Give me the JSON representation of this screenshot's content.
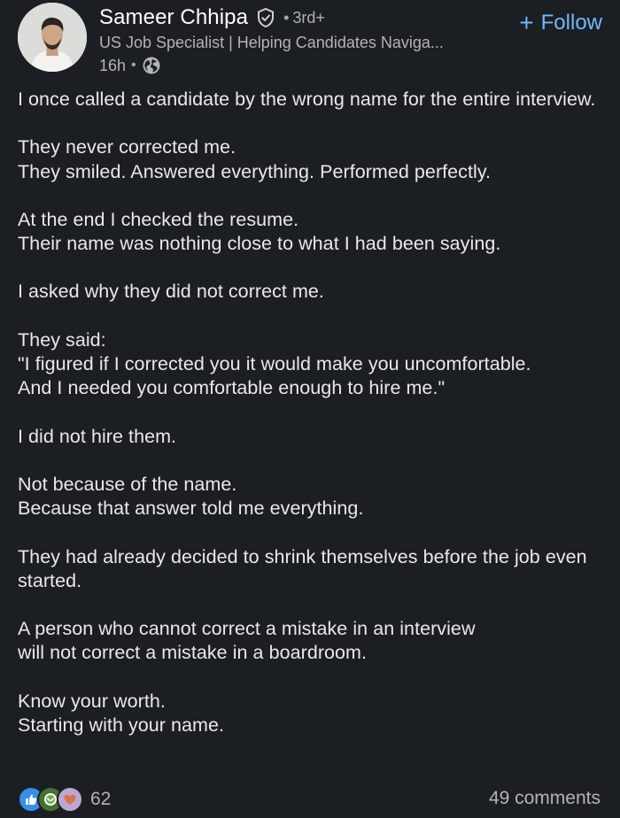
{
  "author": {
    "name": "Sameer Chhipa",
    "degree": "3rd+",
    "separator": "•",
    "headline": "US Job Specialist | Helping Candidates Naviga...",
    "time_ago": "16h"
  },
  "follow": {
    "plus": "+",
    "label": "Follow"
  },
  "post": {
    "paragraphs": [
      "I once called a candidate by the wrong name for the entire interview.",
      "They never corrected me.\nThey smiled. Answered everything. Performed perfectly.",
      "At the end I checked the resume.\nTheir name was nothing close to what I had been saying.",
      "I asked why they did not correct me.",
      "They said:\n\"I figured if I corrected you it would make you uncomfortable.\nAnd I needed you comfortable enough to hire me.\"",
      "I did not hire them.",
      "Not because of the name.\nBecause that answer told me everything.",
      "They had already decided to shrink themselves before the job even started.",
      "A person who cannot correct a mistake in an interview\nwill not correct a mistake in a boardroom.",
      "Know your worth.\nStarting with your name."
    ]
  },
  "social": {
    "reactions": [
      "like-icon",
      "celebrate-icon",
      "support-icon"
    ],
    "reaction_count": "62",
    "comments": "49 comments"
  },
  "colors": {
    "background": "#1b1f23",
    "link": "#71b7fb",
    "like": "#378fe9",
    "celebrate": "#44712e",
    "support": "#bba9d1"
  }
}
